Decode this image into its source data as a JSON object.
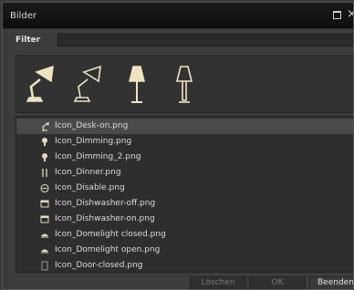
{
  "window": {
    "title": "Bilder"
  },
  "filter": {
    "label": "Filter",
    "value": ""
  },
  "preview": {
    "icons": [
      "desk-lamp-icon",
      "desk-lamp-outline-icon",
      "floor-lamp-icon",
      "floor-lamp-outline-icon"
    ]
  },
  "files": [
    {
      "name": "Icon_Desk-on.png",
      "icon": "desk-lamp-icon",
      "selected": true
    },
    {
      "name": "Icon_Dimming.png",
      "icon": "bulb-icon"
    },
    {
      "name": "Icon_Dimming_2.png",
      "icon": "bulb-icon"
    },
    {
      "name": "Icon_Dinner.png",
      "icon": "cutlery-icon"
    },
    {
      "name": "Icon_Disable.png",
      "icon": "disable-icon"
    },
    {
      "name": "Icon_Dishwasher-off.png",
      "icon": "dishwasher-icon"
    },
    {
      "name": "Icon_Dishwasher-on.png",
      "icon": "dishwasher-icon"
    },
    {
      "name": "Icon_Domelight closed.png",
      "icon": "domelight-icon"
    },
    {
      "name": "Icon_Domelight open.png",
      "icon": "domelight-icon"
    },
    {
      "name": "Icon_Door-closed.png",
      "icon": "door-icon"
    }
  ],
  "buttons": {
    "delete": "Löschen",
    "ok": "OK",
    "quit": "Beenden"
  }
}
